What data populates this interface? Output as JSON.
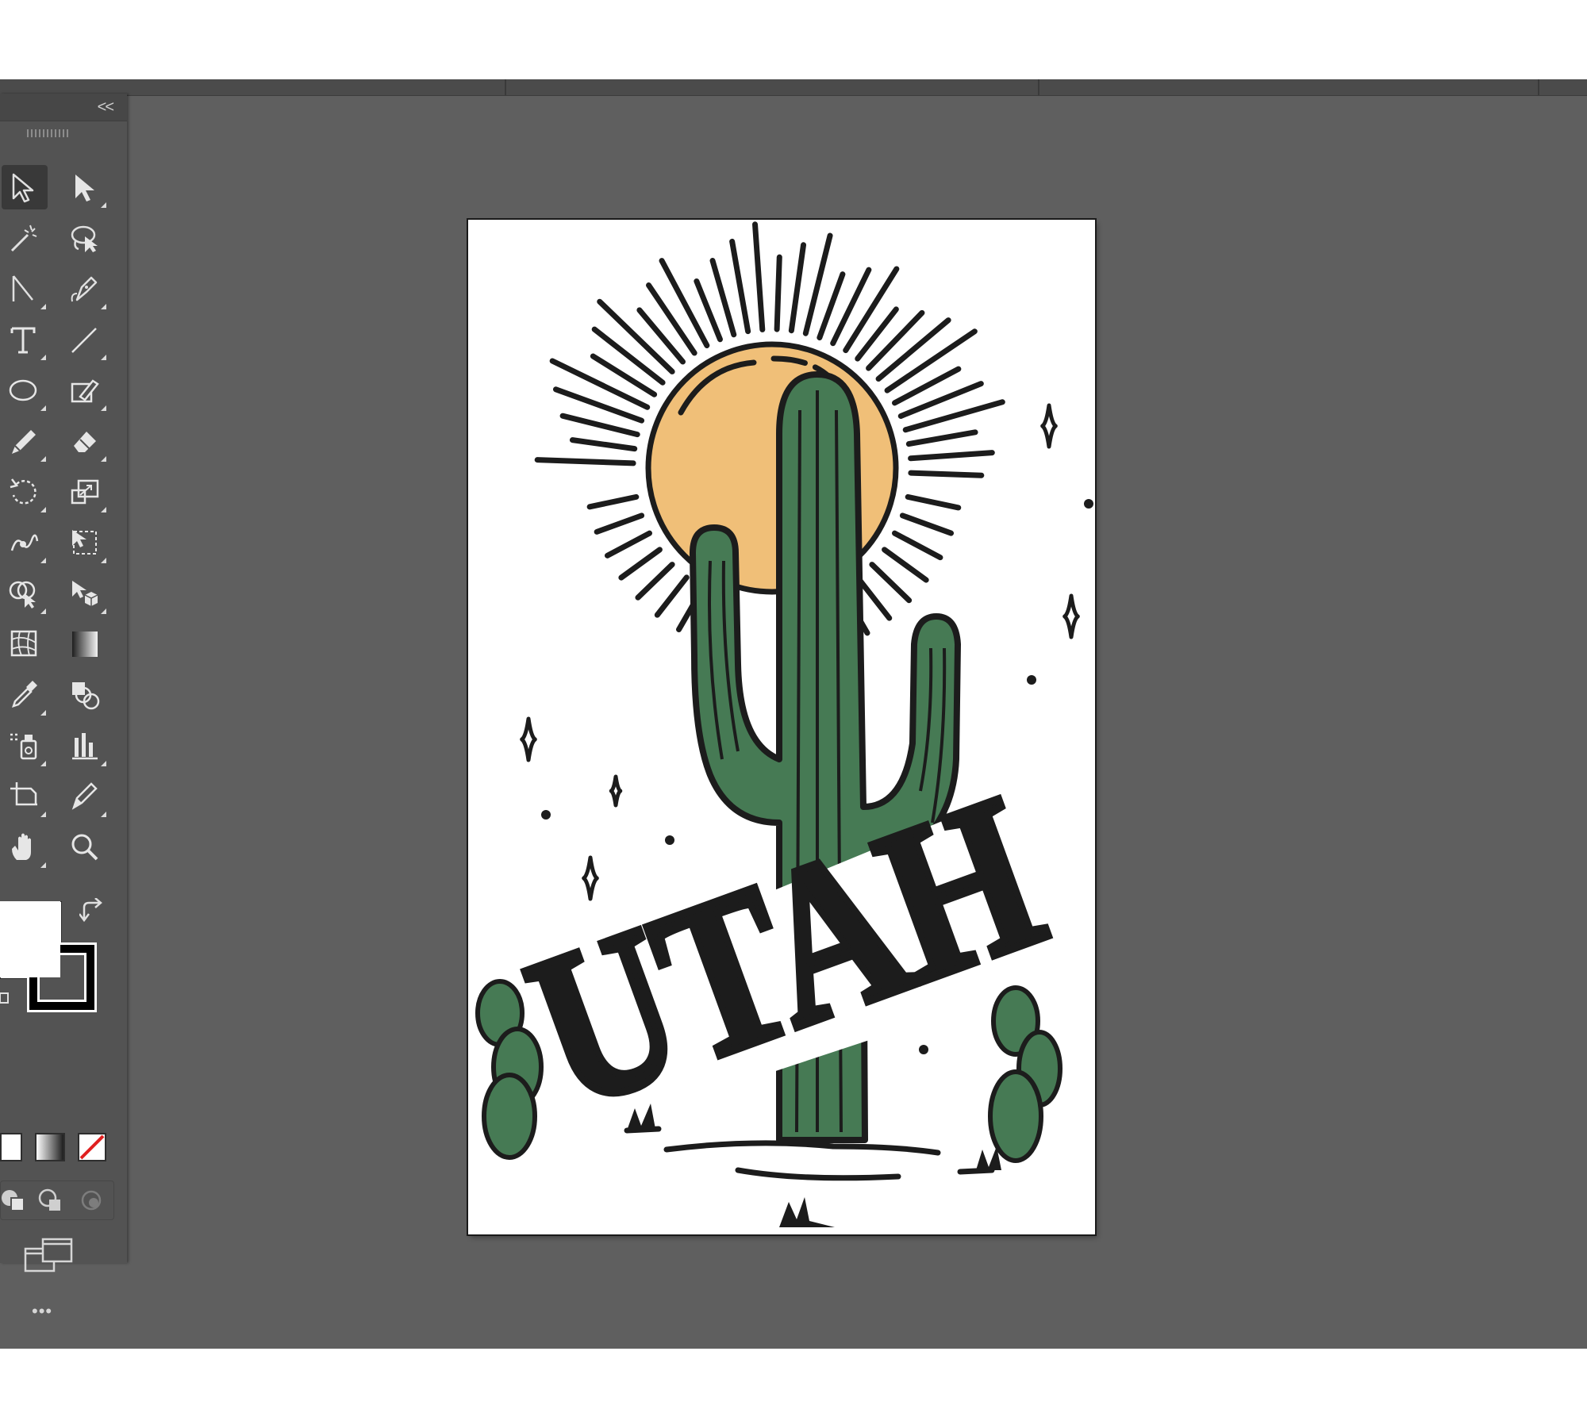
{
  "app": {
    "panel_collapse_label": "<<",
    "more_tools_label": "•••"
  },
  "colors": {
    "canvas": "#5f5f5f",
    "toolbar": "#535353",
    "sun": "#f0bf78",
    "cactus": "#467a54",
    "ink": "#1c1c1c"
  },
  "tools": [
    "selection-tool",
    "direct-selection-tool",
    "magic-wand-tool",
    "lasso-tool",
    "anchor-point-tool",
    "pen-tool",
    "type-tool",
    "line-segment-tool",
    "ellipse-tool",
    "shaper-tool",
    "pencil-tool",
    "eraser-tool",
    "rotate-tool",
    "scale-tool",
    "warp-tool",
    "free-transform-tool",
    "shape-builder-tool",
    "perspective-grid-tool",
    "mesh-tool",
    "gradient-tool",
    "eyedropper-tool",
    "blend-tool",
    "symbol-sprayer-tool",
    "column-graph-tool",
    "artboard-tool",
    "slice-tool",
    "hand-tool",
    "zoom-tool"
  ],
  "artwork": {
    "title_text": "UTAH"
  }
}
